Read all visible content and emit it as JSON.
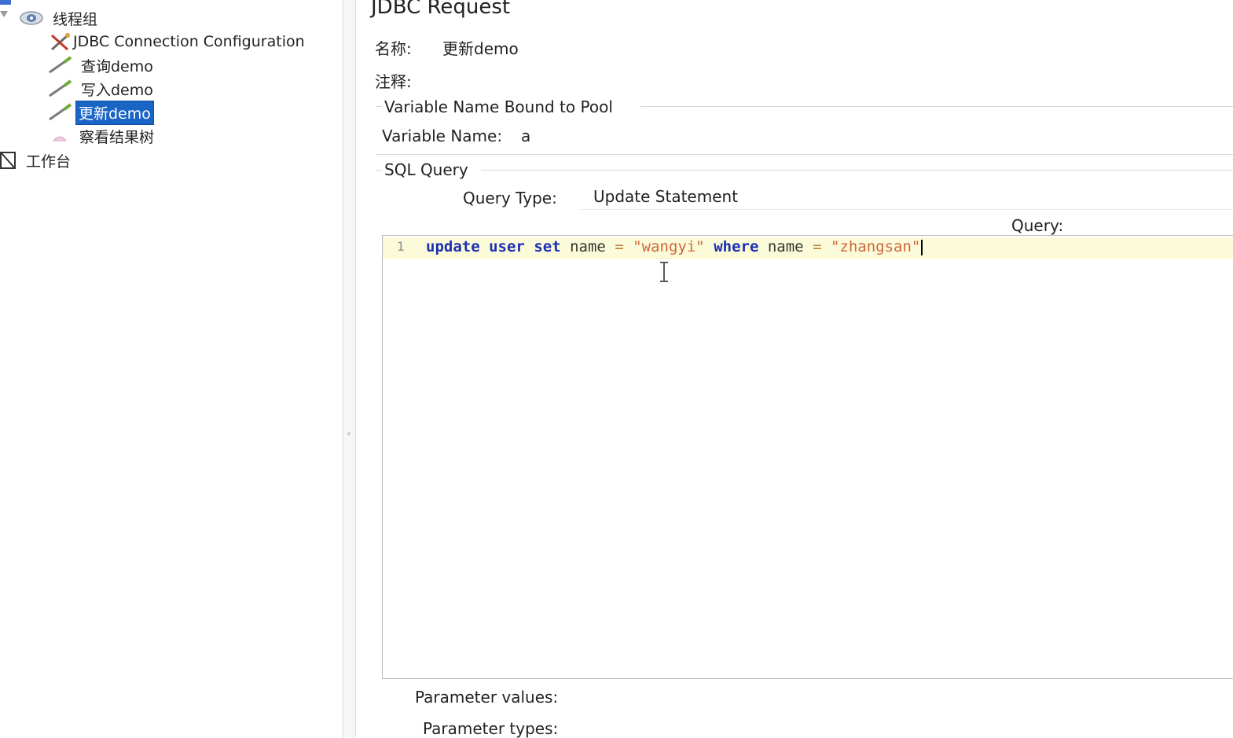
{
  "tree": {
    "items": [
      {
        "label": "线程组"
      },
      {
        "label": "JDBC Connection Configuration"
      },
      {
        "label": "查询demo"
      },
      {
        "label": "写入demo"
      },
      {
        "label": "更新demo",
        "selected": true
      },
      {
        "label": "察看结果树"
      },
      {
        "label": "工作台"
      }
    ]
  },
  "panel": {
    "title": "JDBC Request",
    "name_label": "名称:",
    "name_value": "更新demo",
    "comment_label": "注释:",
    "pool_section": {
      "title": "Variable Name Bound to Pool",
      "variable_label": "Variable Name:",
      "variable_value": "a"
    },
    "sql_section": {
      "title": "SQL Query",
      "query_type_label": "Query Type:",
      "query_type_value": "Update Statement",
      "query_label": "Query:",
      "line_number": "1",
      "tokens": {
        "kw_update": "update",
        "kw_user": "user",
        "kw_set": "set",
        "id_name1": "name",
        "op_eq1": "=",
        "str_wangyi": "\"wangyi\"",
        "kw_where": "where",
        "id_name2": "name",
        "op_eq2": "=",
        "str_zhangsan": "\"zhangsan\""
      }
    },
    "param_values_label": "Parameter values:",
    "param_types_label": "Parameter types:"
  },
  "colors": {
    "selection": "#1a64c6",
    "keyword": "#1c2fb4",
    "string": "#d0653b",
    "current_line": "#fbfbd9"
  }
}
